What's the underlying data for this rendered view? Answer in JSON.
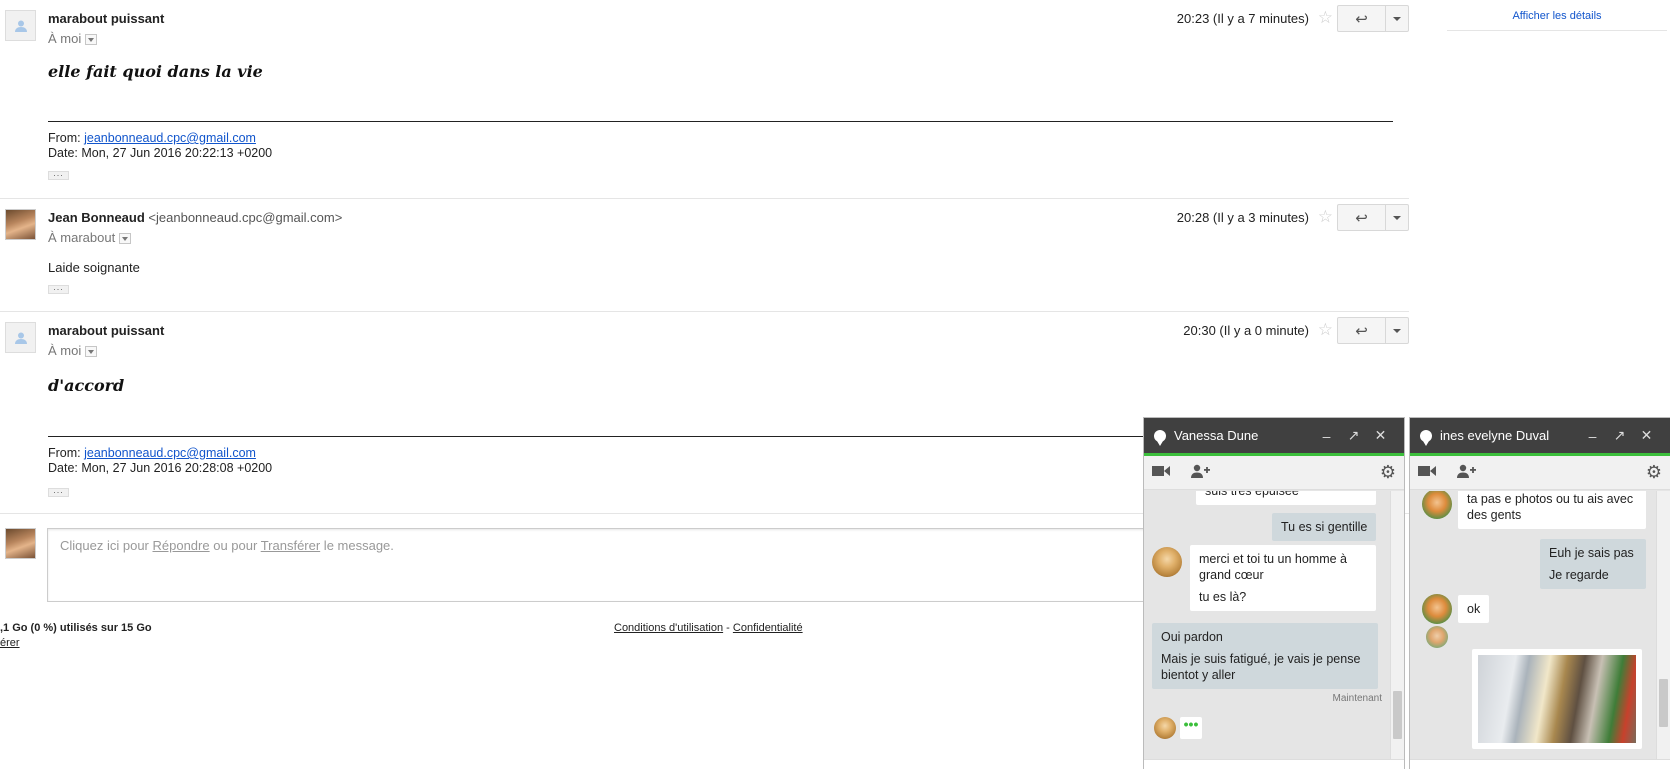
{
  "details_link": "Afficher les détails",
  "messages": [
    {
      "sender": "marabout puissant",
      "to": "À moi",
      "time": "20:23 (Il y a 7 minutes)",
      "body": "elle fait quoi dans la vie",
      "from_label": "From:",
      "from_email": "jeanbonneaud.cpc@gmail.com",
      "date": "Date: Mon, 27 Jun 2016 20:22:13 +0200"
    },
    {
      "sender": "Jean Bonneaud",
      "sender_email": "<jeanbonneaud.cpc@gmail.com>",
      "to": "À marabout",
      "time": "20:28 (Il y a 3 minutes)",
      "body": "Laide soignante"
    },
    {
      "sender": "marabout puissant",
      "to": "À moi",
      "time": "20:30 (Il y a 0 minute)",
      "body": "d'accord",
      "from_label": "From:",
      "from_email": "jeanbonneaud.cpc@gmail.com",
      "date": "Date: Mon, 27 Jun 2016 20:28:08 +0200"
    }
  ],
  "reply_box": {
    "prefix": "Cliquez ici pour ",
    "reply": "Répondre",
    "middle": " ou pour ",
    "forward": "Transférer",
    "suffix": " le message."
  },
  "footer": {
    "storage": ",1 Go (0 %) utilisés sur 15 Go",
    "manage": "érer",
    "terms": "Conditions d'utilisation",
    "sep": " - ",
    "privacy": "Confidentialité"
  },
  "chats": [
    {
      "name": "Vanessa Dune",
      "messages": {
        "cut": "suis très épuisée",
        "out1": "Tu es si gentille",
        "in1a": "merci et toi tu un homme à grand cœur",
        "in1b": "tu es là?",
        "out2a": "Oui pardon",
        "out2b": "Mais je suis fatigué, je vais je pense bientot y aller",
        "stamp": "Maintenant",
        "typing": "•••"
      }
    },
    {
      "name": "ines evelyne Duval",
      "messages": {
        "in1": "ta pas e photos ou tu ais avec des gents",
        "out1a": "Euh je sais pas",
        "out1b": "Je regarde",
        "in2": "ok"
      }
    }
  ],
  "icons": {
    "reply": "↩",
    "star": "☆",
    "minimize": "–",
    "popout": "↗",
    "close": "✕",
    "video": "■",
    "add_person": "+",
    "settings": "⚙"
  }
}
